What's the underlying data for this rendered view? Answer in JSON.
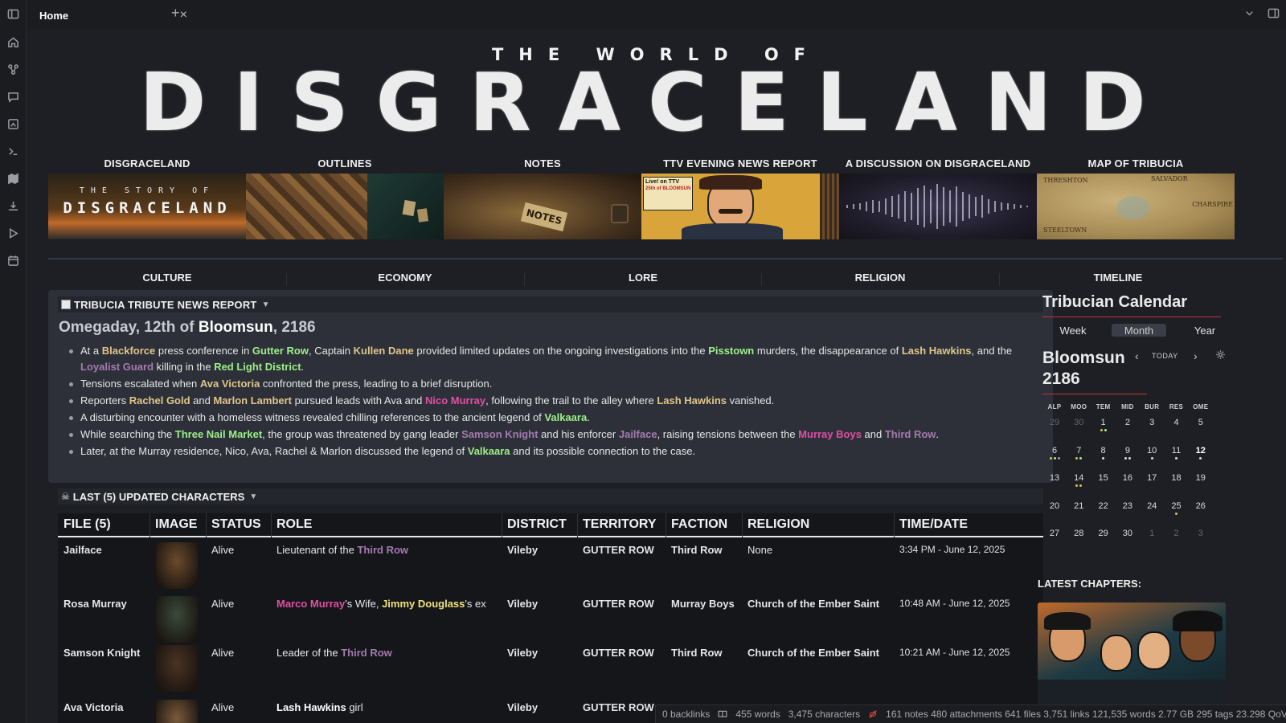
{
  "tab": {
    "title": "Home"
  },
  "hero": {
    "subtitle": "THE WORLD OF",
    "title": "DISGRACELAND"
  },
  "cards": [
    {
      "label": "DISGRACELAND",
      "thumb_text_top": "THE STORY OF",
      "thumb_text_main": "DISGRACELAND"
    },
    {
      "label": "OUTLINES"
    },
    {
      "label": "NOTES",
      "thumb_text_main": "NOTES"
    },
    {
      "label": "TTV EVENING NEWS REPORT",
      "thumb_text_top": "Live! on TTV",
      "thumb_text_main": "25th of BLOOMSUN"
    },
    {
      "label": "A DISCUSSION ON DISGRACELAND"
    },
    {
      "label": "MAP OF TRIBUCIA",
      "thumb_labels": [
        "THRESHTON",
        "SALVADOR",
        "CHARSPIRE",
        "STEELTOWN"
      ]
    }
  ],
  "categories": [
    "CULTURE",
    "ECONOMY",
    "LORE",
    "RELIGION",
    "TIMELINE"
  ],
  "news": {
    "header": "TRIBUCIA TRIBUTE NEWS REPORT",
    "date_prefix": "Omegaday, 12th of",
    "date_month": "Bloomsun",
    "date_year": ", 2186",
    "items": [
      [
        {
          "t": "At a "
        },
        {
          "t": "Blackforce",
          "c": "gold"
        },
        {
          "t": " press conference in "
        },
        {
          "t": "Gutter Row",
          "c": "green"
        },
        {
          "t": ", Captain "
        },
        {
          "t": "Kullen Dane",
          "c": "gold"
        },
        {
          "t": " provided limited updates on the ongoing investigations into the "
        },
        {
          "t": "Pisstown",
          "c": "green"
        },
        {
          "t": " murders, the disappearance of "
        },
        {
          "t": "Lash Hawkins",
          "c": "gold"
        },
        {
          "t": ", and the "
        },
        {
          "t": "Loyalist Guard",
          "c": "purple"
        },
        {
          "t": " killing in the "
        },
        {
          "t": "Red Light District",
          "c": "green"
        },
        {
          "t": "."
        }
      ],
      [
        {
          "t": "Tensions escalated when "
        },
        {
          "t": "Ava Victoria",
          "c": "gold"
        },
        {
          "t": " confronted the press, leading to a brief disruption."
        }
      ],
      [
        {
          "t": "Reporters "
        },
        {
          "t": "Rachel Gold",
          "c": "gold"
        },
        {
          "t": " and "
        },
        {
          "t": "Marlon Lambert",
          "c": "gold"
        },
        {
          "t": " pursued leads with Ava and "
        },
        {
          "t": "Nico Murray",
          "c": "pink"
        },
        {
          "t": ", following the trail to the alley where "
        },
        {
          "t": "Lash Hawkins",
          "c": "gold"
        },
        {
          "t": " vanished."
        }
      ],
      [
        {
          "t": "A disturbing encounter with a homeless witness revealed chilling references to the ancient legend of "
        },
        {
          "t": "Valkaara",
          "c": "green"
        },
        {
          "t": "."
        }
      ],
      [
        {
          "t": "While searching the "
        },
        {
          "t": "Three Nail Market",
          "c": "green"
        },
        {
          "t": ", the group was threatened by gang leader "
        },
        {
          "t": "Samson Knight",
          "c": "purple"
        },
        {
          "t": " and his enforcer "
        },
        {
          "t": "Jailface",
          "c": "purple"
        },
        {
          "t": ", raising tensions between the "
        },
        {
          "t": "Murray Boys",
          "c": "pink"
        },
        {
          "t": " and "
        },
        {
          "t": "Third Row",
          "c": "purple"
        },
        {
          "t": "."
        }
      ],
      [
        {
          "t": "Later, at the Murray residence, Nico, Ava, Rachel & Marlon discussed the legend of "
        },
        {
          "t": "Valkaara",
          "c": "green"
        },
        {
          "t": " and its possible connection to the case."
        }
      ]
    ]
  },
  "characters": {
    "header": "LAST (5) UPDATED CHARACTERS",
    "columns": [
      "FILE (5)",
      "IMAGE",
      "STATUS",
      "ROLE",
      "DISTRICT",
      "TERRITORY",
      "FACTION",
      "RELIGION",
      "TIME/DATE"
    ],
    "rows": [
      {
        "file": "Jailface",
        "file_color": "purple",
        "status": "Alive",
        "role": [
          {
            "t": "Lieutenant of the "
          },
          {
            "t": "Third Row",
            "c": "purple"
          }
        ],
        "district": "Vileby",
        "territory": "GUTTER ROW",
        "faction": "Third Row",
        "faction_color": "purple",
        "religion": "None",
        "religion_bold": false,
        "time": "3:34 PM - June 12, 2025",
        "portrait": "#6b4a2c"
      },
      {
        "file": "Rosa Murray",
        "file_color": "pink",
        "status": "Alive",
        "role": [
          {
            "t": "Marco Murray",
            "c": "pink"
          },
          {
            "t": "'s Wife, "
          },
          {
            "t": "Jimmy Douglass",
            "c": "yellow"
          },
          {
            "t": "'s ex"
          }
        ],
        "district": "Vileby",
        "territory": "GUTTER ROW",
        "faction": "Murray Boys",
        "faction_color": "pink",
        "religion": "Church of the Ember Saint",
        "religion_bold": true,
        "time": "10:48 AM - June 12, 2025",
        "portrait": "#3a4a3a"
      },
      {
        "file": "Samson Knight",
        "file_color": "purple",
        "status": "Alive",
        "role": [
          {
            "t": "Leader of the "
          },
          {
            "t": "Third Row",
            "c": "purple"
          }
        ],
        "district": "Vileby",
        "territory": "GUTTER ROW",
        "faction": "Third Row",
        "faction_color": "purple",
        "religion": "Church of the Ember Saint",
        "religion_bold": true,
        "time": "10:21 AM - June 12, 2025",
        "portrait": "#4b3322"
      },
      {
        "file": "Ava Victoria",
        "file_color": "gold",
        "status": "Alive",
        "role": [
          {
            "t": "Lash Hawkins",
            "c": "white"
          },
          {
            "t": " girl"
          }
        ],
        "district": "Vileby",
        "territory": "GUTTER ROW",
        "faction": "",
        "faction_color": "purple",
        "religion": "",
        "religion_bold": true,
        "time": "",
        "portrait": "#7a5a3a"
      }
    ]
  },
  "calendar": {
    "title": "Tribucian Calendar",
    "views": [
      "Week",
      "Month",
      "Year"
    ],
    "active_view": "Month",
    "month": "Bloomsun",
    "year": "2186",
    "today_label": "TODAY",
    "weekdays": [
      "ALP",
      "MOO",
      "TEM",
      "MID",
      "BUR",
      "RES",
      "OME"
    ],
    "weeks": [
      [
        {
          "d": "29",
          "m": true
        },
        {
          "d": "30",
          "m": true
        },
        {
          "d": "1",
          "dots": [
            "#e0c04a",
            "#9df08a"
          ]
        },
        {
          "d": "2"
        },
        {
          "d": "3"
        },
        {
          "d": "4"
        },
        {
          "d": "5"
        }
      ],
      [
        {
          "d": "6",
          "dots": [
            "#e0c04a",
            "#9df08a",
            "#9a9ca4"
          ]
        },
        {
          "d": "7",
          "dots": [
            "#e0c04a",
            "#9df08a"
          ]
        },
        {
          "d": "8",
          "dots": [
            "#dcdcdc"
          ]
        },
        {
          "d": "9",
          "dots": [
            "#dcdcdc",
            "#dcdcdc"
          ]
        },
        {
          "d": "10",
          "dots": [
            "#dcdcdc"
          ]
        },
        {
          "d": "11",
          "dots": [
            "#dcdcdc"
          ]
        },
        {
          "d": "12",
          "today": true,
          "dots": [
            "#dcdcdc"
          ]
        }
      ],
      [
        {
          "d": "13"
        },
        {
          "d": "14",
          "dots": [
            "#e0c04a",
            "#e0c04a"
          ]
        },
        {
          "d": "15"
        },
        {
          "d": "16"
        },
        {
          "d": "17"
        },
        {
          "d": "18"
        },
        {
          "d": "19"
        }
      ],
      [
        {
          "d": "20"
        },
        {
          "d": "21"
        },
        {
          "d": "22"
        },
        {
          "d": "23"
        },
        {
          "d": "24"
        },
        {
          "d": "25",
          "dots": [
            "#e0c04a"
          ]
        },
        {
          "d": "26"
        }
      ],
      [
        {
          "d": "27"
        },
        {
          "d": "28"
        },
        {
          "d": "29"
        },
        {
          "d": "30"
        },
        {
          "d": "1",
          "m": true
        },
        {
          "d": "2",
          "m": true
        },
        {
          "d": "3",
          "m": true
        }
      ]
    ],
    "latest_label": "LATEST CHAPTERS:"
  },
  "statusbar": {
    "backlinks": "0 backlinks",
    "words": "455 words",
    "characters": "3,475 characters",
    "vault_stats": "161 notes 480 attachments 641 files 3,751 links 121,535 words 2.77 GB 295 tags 23.298 QoV"
  },
  "colors": {
    "gold": "#e0c68a",
    "green": "#9df08a",
    "pink": "#e04fa5",
    "purple": "#a67ab0",
    "yellow": "#f0e07a",
    "white": "#ffffff",
    "accent_red": "#c03535"
  },
  "icons": {
    "ribbon": [
      "sidebar-toggle-icon",
      "home-icon",
      "graph-icon",
      "chat-icon",
      "canvas-icon",
      "terminal-icon",
      "map-icon",
      "download-icon",
      "play-icon",
      "calendar-icon"
    ]
  }
}
